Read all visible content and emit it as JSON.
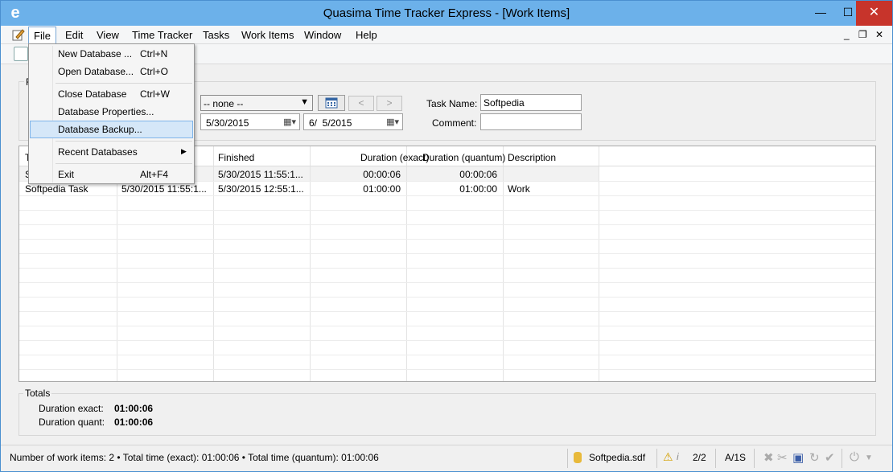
{
  "window": {
    "title": "Quasima Time Tracker Express - [Work Items]",
    "controls": {
      "minimize": "—",
      "maximize": "☐",
      "close": "✕"
    }
  },
  "menubar": {
    "items": [
      "File",
      "Edit",
      "View",
      "Time Tracker",
      "Tasks",
      "Work Items",
      "Window",
      "Help"
    ],
    "mdi": {
      "minimize": "_",
      "restore": "❐",
      "close": "✕"
    }
  },
  "file_menu": {
    "items": [
      {
        "label": "New Database ...",
        "shortcut": "Ctrl+N"
      },
      {
        "label": "Open Database...",
        "shortcut": "Ctrl+O"
      },
      {
        "label": "Close Database",
        "shortcut": "Ctrl+W"
      },
      {
        "label": "Database Properties...",
        "shortcut": ""
      },
      {
        "label": "Database Backup...",
        "shortcut": ""
      },
      {
        "label": "Recent Databases",
        "shortcut": ""
      },
      {
        "label": "Exit",
        "shortcut": "Alt+F4"
      }
    ],
    "highlighted": "Database Backup...",
    "submenu_arrow": "▶"
  },
  "filter": {
    "group_label": "F",
    "period_select": "-- none --",
    "prev": "<",
    "next": ">",
    "date_from": "5/30/2015",
    "date_to": "6/  5/2015",
    "task_name_label": "Task Name:",
    "task_name_value": "Softpedia",
    "comment_label": "Comment:",
    "comment_value": ""
  },
  "grid": {
    "columns": [
      "T",
      "",
      "Finished",
      "Duration (exact)",
      "Duration (quantum)",
      "Description"
    ],
    "rows": [
      {
        "task": "S",
        "started": "",
        "finished": "5/30/2015 11:55:1...",
        "exact": "00:00:06",
        "quantum": "00:00:06",
        "description": ""
      },
      {
        "task": "Softpedia Task",
        "started": "5/30/2015 11:55:1...",
        "finished": "5/30/2015 12:55:1...",
        "exact": "01:00:00",
        "quantum": "01:00:00",
        "description": "Work"
      }
    ]
  },
  "totals": {
    "label": "Totals",
    "exact_label": "Duration exact:",
    "exact_value": "01:00:06",
    "quant_label": "Duration quant:",
    "quant_value": "01:00:06"
  },
  "statusbar": {
    "summary": "Number of work items: 2 • Total time (exact): 01:00:06 • Total time (quantum): 01:00:06",
    "db_file": "Softpedia.sdf",
    "page": "2/2",
    "mode": "A/1S"
  }
}
